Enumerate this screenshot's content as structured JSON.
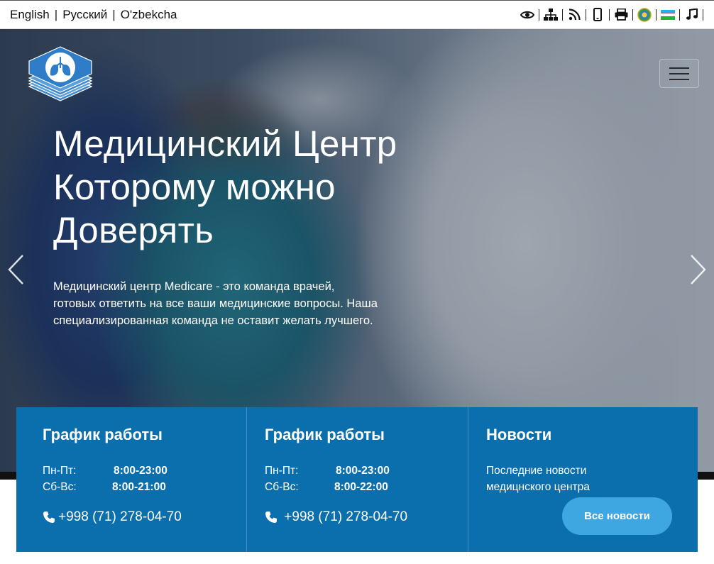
{
  "topbar": {
    "languages": [
      {
        "label": "English"
      },
      {
        "label": "Русский"
      },
      {
        "label": "O'zbekcha"
      }
    ],
    "tools": [
      "eye-icon",
      "sitemap-icon",
      "rss-icon",
      "mobile-icon",
      "print-icon",
      "emblem-icon",
      "uz-flag-icon",
      "music-icon"
    ]
  },
  "hero": {
    "title_lines": [
      "Медицинский Центр",
      "Которому можно",
      "Доверять"
    ],
    "description_lines": [
      "Медицинский центр Medicare - это команда врачей,",
      "готовых ответить на все ваши медицинские вопросы. Наша",
      "специализированная команда не оставит желать лучшего."
    ]
  },
  "panels": {
    "schedule1": {
      "title": "График работы",
      "rows": [
        {
          "day": "Пн-Пт:",
          "time": "8:00-23:00"
        },
        {
          "day": "Сб-Вс:",
          "time": "8:00-21:00"
        }
      ],
      "phone": "+998 (71) 278-04-70"
    },
    "schedule2": {
      "title": "График работы",
      "rows": [
        {
          "day": "Пн-Пт:",
          "time": "8:00-23:00"
        },
        {
          "day": "Сб-Вс:",
          "time": "8:00-22:00"
        }
      ],
      "phone": " +998 (71) 278-04-70"
    },
    "news": {
      "title": "Новости",
      "text_lines": [
        "Последние новости",
        "медицнского центра"
      ],
      "button": "Все новости"
    }
  },
  "colors": {
    "panel_bg": "#0b6fae",
    "button_bg": "#3ea6e0",
    "text_light": "#ffffff"
  }
}
